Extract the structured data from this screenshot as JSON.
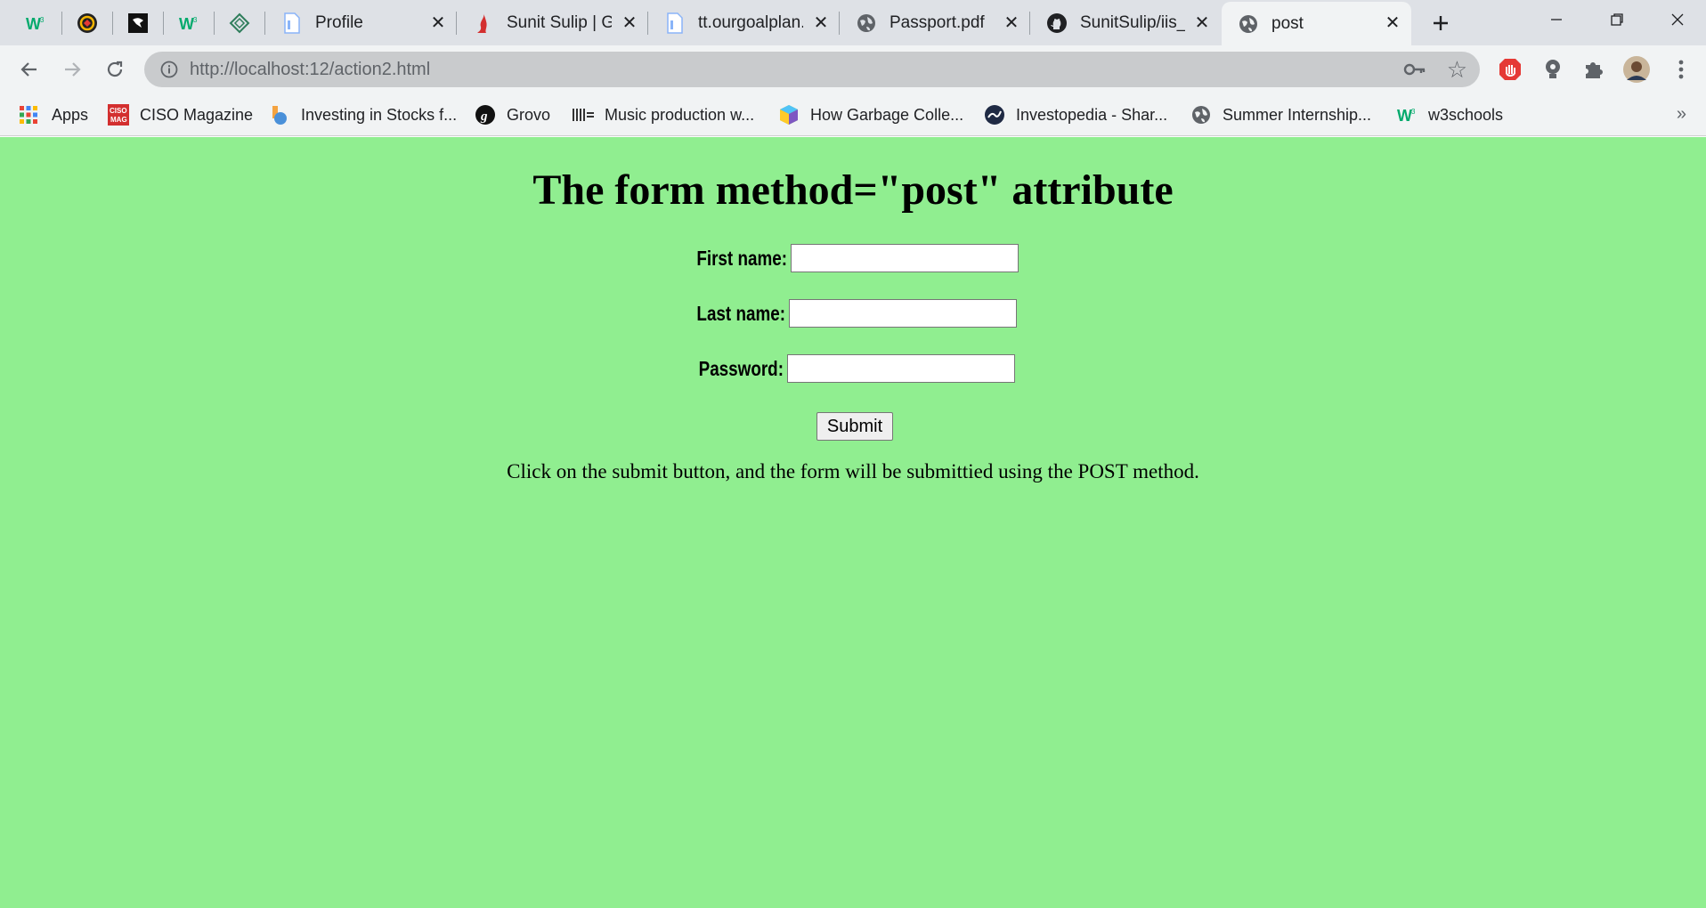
{
  "tabs": [
    {
      "title": "",
      "icon": "w3schools-icon",
      "active": false
    },
    {
      "title": "",
      "icon": "colorful-circle-icon",
      "active": false
    },
    {
      "title": "",
      "icon": "black-square-icon",
      "active": false
    },
    {
      "title": "",
      "icon": "w3schools-icon",
      "active": false
    },
    {
      "title": "",
      "icon": "diamond-logo-icon",
      "active": false
    },
    {
      "title": "Profile",
      "icon": "document-icon",
      "active": false
    },
    {
      "title": "Sunit Sulip | Gc",
      "icon": "red-flame-icon",
      "active": false
    },
    {
      "title": "tt.ourgoalplan.",
      "icon": "document-icon",
      "active": false
    },
    {
      "title": "Passport.pdf",
      "icon": "globe-icon",
      "active": false
    },
    {
      "title": "SunitSulip/iis_s",
      "icon": "github-icon",
      "active": false
    },
    {
      "title": "post",
      "icon": "globe-icon",
      "active": true
    }
  ],
  "address": {
    "url": "http://localhost:12/action2.html"
  },
  "bookmarks": [
    {
      "label": "Apps",
      "icon": "apps-grid-icon"
    },
    {
      "label": "CISO Magazine",
      "icon": "ciso-mag-icon"
    },
    {
      "label": "Investing in Stocks f...",
      "icon": "investing-icon"
    },
    {
      "label": "Grovo",
      "icon": "grovo-icon"
    },
    {
      "label": "Music production w...",
      "icon": "music-bars-icon"
    },
    {
      "label": "How Garbage Colle...",
      "icon": "cube-icon"
    },
    {
      "label": "Investopedia - Shar...",
      "icon": "investopedia-icon"
    },
    {
      "label": "Summer Internship...",
      "icon": "globe-icon"
    },
    {
      "label": "w3schools",
      "icon": "w3schools-icon"
    }
  ],
  "bookmarks_more": "»",
  "page": {
    "background": "#90ee90",
    "heading": "The form method=\"post\" attribute",
    "fields": [
      {
        "label": "First name:",
        "value": ""
      },
      {
        "label": "Last name:",
        "value": ""
      },
      {
        "label": "Password:",
        "value": ""
      }
    ],
    "submit_label": "Submit",
    "note": "Click on the submit button, and the form will be submittied using the POST method."
  }
}
